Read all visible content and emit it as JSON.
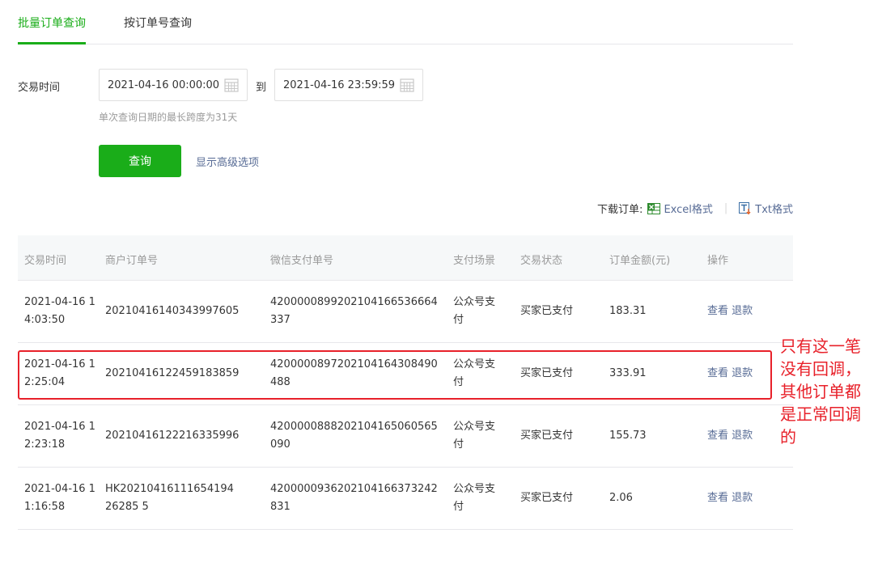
{
  "tabs": [
    {
      "label": "批量订单查询",
      "active": true
    },
    {
      "label": "按订单号查询",
      "active": false
    }
  ],
  "filter": {
    "time_label": "交易时间",
    "start": "2021-04-16 00:00:00",
    "to_label": "到",
    "end": "2021-04-16 23:59:59",
    "hint": "单次查询日期的最长跨度为31天",
    "query_button": "查询",
    "advanced_link": "显示高级选项"
  },
  "download": {
    "label": "下载订单:",
    "excel": "Excel格式",
    "separator": "|",
    "txt": "Txt格式"
  },
  "table": {
    "headers": [
      "交易时间",
      "商户订单号",
      "微信支付单号",
      "支付场景",
      "交易状态",
      "订单金额(元)",
      "操作"
    ],
    "rows": [
      {
        "time": "2021-04-16 14:03:50",
        "mch": "20210416140343997605",
        "wx": "4200000899202104166536664337",
        "scene": "公众号支付",
        "status": "买家已支付",
        "amount": "183.31",
        "view": "查看",
        "refund": "退款"
      },
      {
        "time": "2021-04-16 12:25:04",
        "mch": "20210416122459183859",
        "wx": "4200000897202104164308490488",
        "scene": "公众号支付",
        "status": "买家已支付",
        "amount": "333.91",
        "view": "查看",
        "refund": "退款"
      },
      {
        "time": "2021-04-16 12:23:18",
        "mch": "20210416122216335996",
        "wx": "4200000888202104165060565090",
        "scene": "公众号支付",
        "status": "买家已支付",
        "amount": "155.73",
        "view": "查看",
        "refund": "退款"
      },
      {
        "time": "2021-04-16 11:16:58",
        "mch": "HK2021041611165419426285 5",
        "wx": "4200000936202104166373242831",
        "scene": "公众号支付",
        "status": "买家已支付",
        "amount": "2.06",
        "view": "查看",
        "refund": "退款"
      }
    ]
  },
  "annotation": {
    "text": "只有这一笔没有回调，其他订单都是正常回调的",
    "color": "#e8212a"
  },
  "colors": {
    "accent": "#1aad19",
    "link": "#576b95",
    "muted": "#9a9a9a"
  }
}
